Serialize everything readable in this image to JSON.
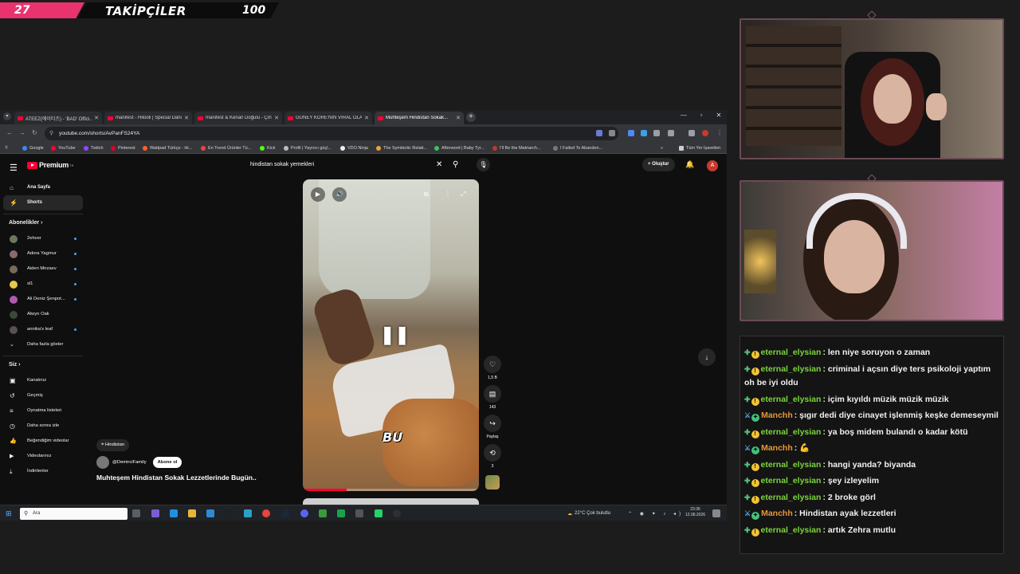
{
  "banner": {
    "count": "27",
    "title": "TAKİPÇİLER",
    "goal": "100"
  },
  "browser": {
    "tabs": [
      {
        "label": "ATEEZ(에이티즈) - 'BAD' Offici...",
        "active": false
      },
      {
        "label": "manifest - Hilooli | Special Danc...",
        "active": false
      },
      {
        "label": "manifest & Kenan Doğulu - Çıh...",
        "active": false
      },
      {
        "label": "GÜNEY KORE'NİN VİRAL OLAN...",
        "active": false
      },
      {
        "label": "Muhteşem Hindistan Sokak...",
        "active": true
      }
    ],
    "url": "youtube.com/shorts/AvPanFS24YA",
    "bookmarks": [
      "Google",
      "YouTube",
      "Twitch",
      "Pinterest",
      "Wattpad Türkçe - Hi...",
      "En Trend Ürünler Tü...",
      "Kick",
      "Profil | Yayıncı güçl...",
      "VDO.Ninja",
      "The Symbiotic Relati...",
      "Afterword | Baby Tyr...",
      "I'll Be the Matriarch...",
      "I Failed To Abandon..."
    ],
    "bookmarks_all": "Tüm Yer İşaretleri"
  },
  "youtube": {
    "logo": "Premium",
    "logo_sup": "TR",
    "search_value": "hindistan sokak yemekleri",
    "create_label": "Oluştur",
    "avatar_letter": "A",
    "nav": [
      {
        "label": "Ana Sayfa",
        "icon": "⌂"
      },
      {
        "label": "Shorts",
        "icon": "⚡"
      }
    ],
    "subs_header": "Abonelikler",
    "subs": [
      {
        "label": "2ehver",
        "color": "#6a7a58"
      },
      {
        "label": "Adora Yagmur",
        "color": "#8a6a70"
      },
      {
        "label": "Aiden Mirzaev",
        "color": "#7a6a5a"
      },
      {
        "label": "sl1",
        "color": "#e6c84a"
      },
      {
        "label": "Ali Deniz Şenpot...",
        "color": "#b05ab0"
      },
      {
        "label": "Alwyn Oak",
        "color": "#3a4a3a"
      },
      {
        "label": "annika's leaf",
        "color": "#5a5050"
      }
    ],
    "show_more": "Daha fazla göster",
    "you_header": "Siz",
    "you_items": [
      {
        "label": "Kanalınız",
        "icon": "▣"
      },
      {
        "label": "Geçmiş",
        "icon": "↺"
      },
      {
        "label": "Oynatma listeleri",
        "icon": "≡"
      },
      {
        "label": "Daha sonra izle",
        "icon": "◷"
      },
      {
        "label": "Beğendiğim videolar",
        "icon": "👍"
      },
      {
        "label": "Videolarınız",
        "icon": "▶"
      },
      {
        "label": "İndirilenler",
        "icon": "⤓"
      }
    ],
    "video": {
      "caption": "BU",
      "progress": 0.25,
      "likes": "1,5 B",
      "comments": "143",
      "share": "Paylaş",
      "remix": "3",
      "location_tag": "Hindistan",
      "channel": "@DemirciFamily",
      "subscribe": "Abone ol",
      "title": "Muhteşem Hindistan Sokak Lezzetlerinde Bugün.."
    }
  },
  "taskbar": {
    "search_placeholder": "Ara",
    "weather": "22°C  Çok bulutlu",
    "time": "23:36",
    "date": "12.08.2026"
  },
  "chat": [
    {
      "user": "eternal_elysian",
      "color": "#7bd43c",
      "badge": "green",
      "text": "len niye soruyon o zaman"
    },
    {
      "user": "eternal_elysian",
      "color": "#7bd43c",
      "badge": "green",
      "text": "criminal i açsın diye ters psikoloji yaptım oh be iyi oldu"
    },
    {
      "user": "eternal_elysian",
      "color": "#7bd43c",
      "badge": "green",
      "text": "içim kıyıldı müzik müzik müzik"
    },
    {
      "user": "Manchh",
      "color": "#e8963a",
      "badge": "blue",
      "text": "şıgır dedi diye cinayet işlenmiş keşke demeseymil"
    },
    {
      "user": "eternal_elysian",
      "color": "#7bd43c",
      "badge": "green",
      "text": "ya boş midem bulandı o kadar kötü"
    },
    {
      "user": "Manchh",
      "color": "#e8963a",
      "badge": "blue",
      "text": "💪"
    },
    {
      "user": "eternal_elysian",
      "color": "#7bd43c",
      "badge": "green",
      "text": "hangi yanda? biyanda"
    },
    {
      "user": "eternal_elysian",
      "color": "#7bd43c",
      "badge": "green",
      "text": "şey izleyelim"
    },
    {
      "user": "eternal_elysian",
      "color": "#7bd43c",
      "badge": "green",
      "text": "2 broke görl"
    },
    {
      "user": "Manchh",
      "color": "#e8963a",
      "badge": "blue",
      "text": "Hindistan ayak lezzetleri"
    },
    {
      "user": "eternal_elysian",
      "color": "#7bd43c",
      "badge": "green",
      "text": "artık Zehra mutlu"
    }
  ],
  "colors": {
    "brand_red": "#ff0033",
    "banner_pink": "#e8336f"
  }
}
